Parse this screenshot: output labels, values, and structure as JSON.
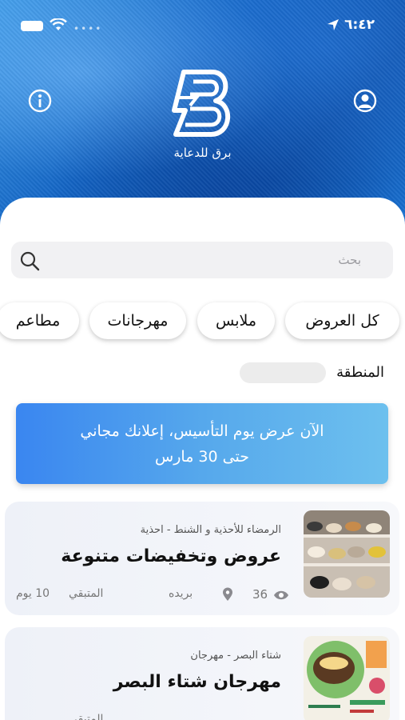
{
  "status_bar": {
    "time": "٦:٤٢"
  },
  "header": {
    "brand_name": "برق للدعاية"
  },
  "search": {
    "placeholder": "بحث"
  },
  "categories": [
    {
      "label": "كل العروض"
    },
    {
      "label": "ملابس"
    },
    {
      "label": "مهرجانات"
    },
    {
      "label": "مطاعم"
    }
  ],
  "filter": {
    "region_label": "المنطقة",
    "region_value": ""
  },
  "banner": {
    "line1": "الآن عرض يوم التأسيس، إعلانك مجاني",
    "line2": "حتى 30 مارس"
  },
  "offers": [
    {
      "subtitle": "الرمضاء للأحذية و الشنط - احذية",
      "title": "عروض وتخفيضات متنوعة",
      "remaining_label": "المتبقي",
      "remaining_value": "10 يوم",
      "city": "بريده",
      "views": "36"
    },
    {
      "subtitle": "شتاء البصر - مهرجان",
      "title": "مهرجان شتاء البصر",
      "remaining_label": "المتبقي",
      "remaining_value": "",
      "city": "",
      "views": ""
    }
  ],
  "colors": {
    "accent": "#3a86f0",
    "hero_dark": "#0b4ea8"
  },
  "icons": [
    "info-icon",
    "profile-icon",
    "search-icon",
    "location-pin-icon",
    "eye-icon"
  ]
}
